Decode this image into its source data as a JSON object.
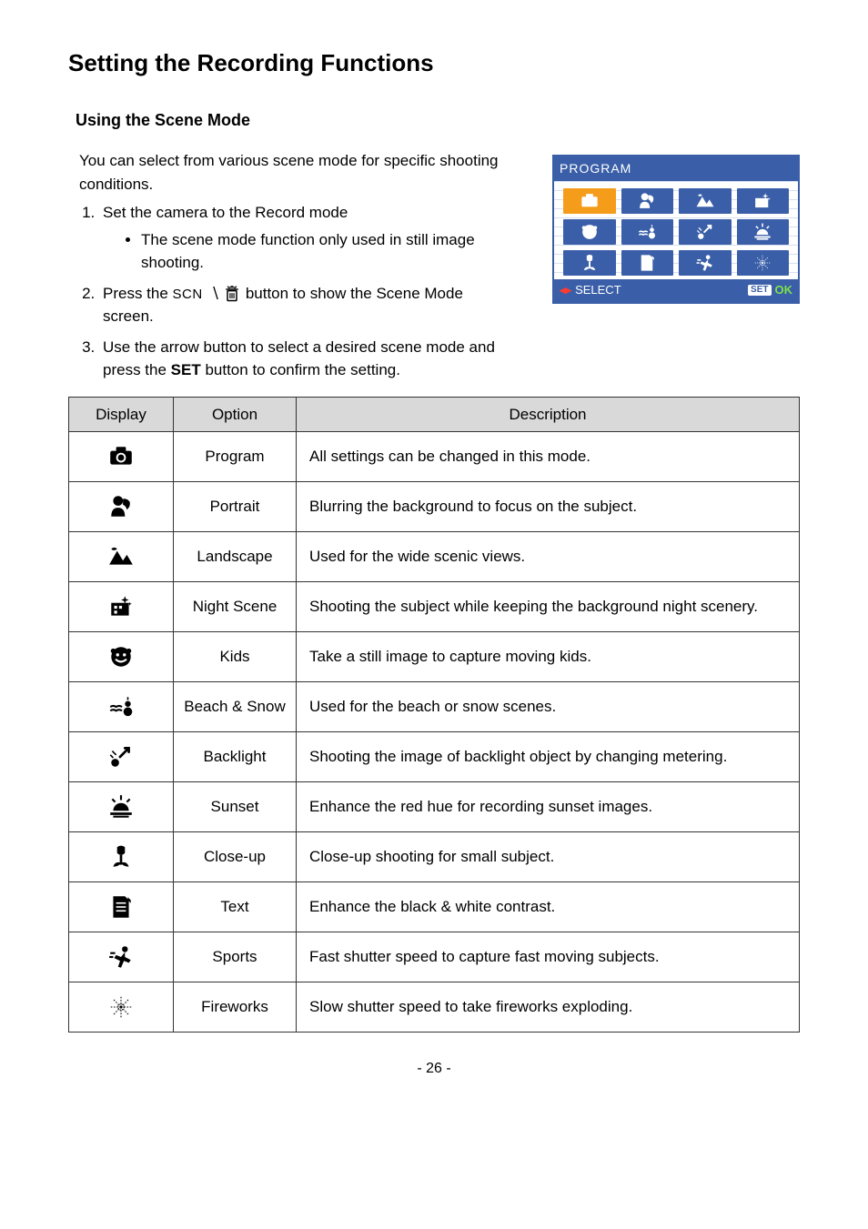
{
  "title": "Setting the Recording Functions",
  "subtitle": "Using the Scene Mode",
  "intro": "You can select from various scene mode for specific shooting conditions.",
  "steps": {
    "s1": "Set the camera to the Record mode",
    "s1_bullet": "The scene mode function only used in still image shooting.",
    "s2_a": "Press the ",
    "s2_b": " button to show the Scene Mode screen.",
    "s3_a": "Use the arrow button to select a desired scene mode and press the ",
    "s3_set": "SET",
    "s3_b": " button to confirm the setting."
  },
  "scn_label": "SCN",
  "panel": {
    "title": "PROGRAM",
    "select": "SELECT",
    "set": "SET",
    "ok": "OK"
  },
  "table": {
    "headers": {
      "display": "Display",
      "option": "Option",
      "description": "Description"
    },
    "rows": [
      {
        "icon": "program",
        "option": "Program",
        "desc": "All settings can be changed in this mode."
      },
      {
        "icon": "portrait",
        "option": "Portrait",
        "desc": "Blurring the background to focus on the subject."
      },
      {
        "icon": "landscape",
        "option": "Landscape",
        "desc": "Used for the wide scenic views."
      },
      {
        "icon": "nightscene",
        "option": "Night Scene",
        "desc": "Shooting the subject while keeping the background night scenery."
      },
      {
        "icon": "kids",
        "option": "Kids",
        "desc": "Take a still image to capture moving kids."
      },
      {
        "icon": "beachsnow",
        "option": "Beach & Snow",
        "desc": "Used for the beach or snow scenes."
      },
      {
        "icon": "backlight",
        "option": "Backlight",
        "desc": "Shooting the image of backlight object by changing metering."
      },
      {
        "icon": "sunset",
        "option": "Sunset",
        "desc": "Enhance the red hue for recording sunset images."
      },
      {
        "icon": "closeup",
        "option": "Close-up",
        "desc": "Close-up shooting for small subject."
      },
      {
        "icon": "text",
        "option": "Text",
        "desc": "Enhance the black & white contrast."
      },
      {
        "icon": "sports",
        "option": "Sports",
        "desc": "Fast shutter speed to capture fast moving subjects."
      },
      {
        "icon": "fireworks",
        "option": "Fireworks",
        "desc": "Slow shutter speed to take fireworks exploding."
      }
    ]
  },
  "page_number": "- 26 -"
}
